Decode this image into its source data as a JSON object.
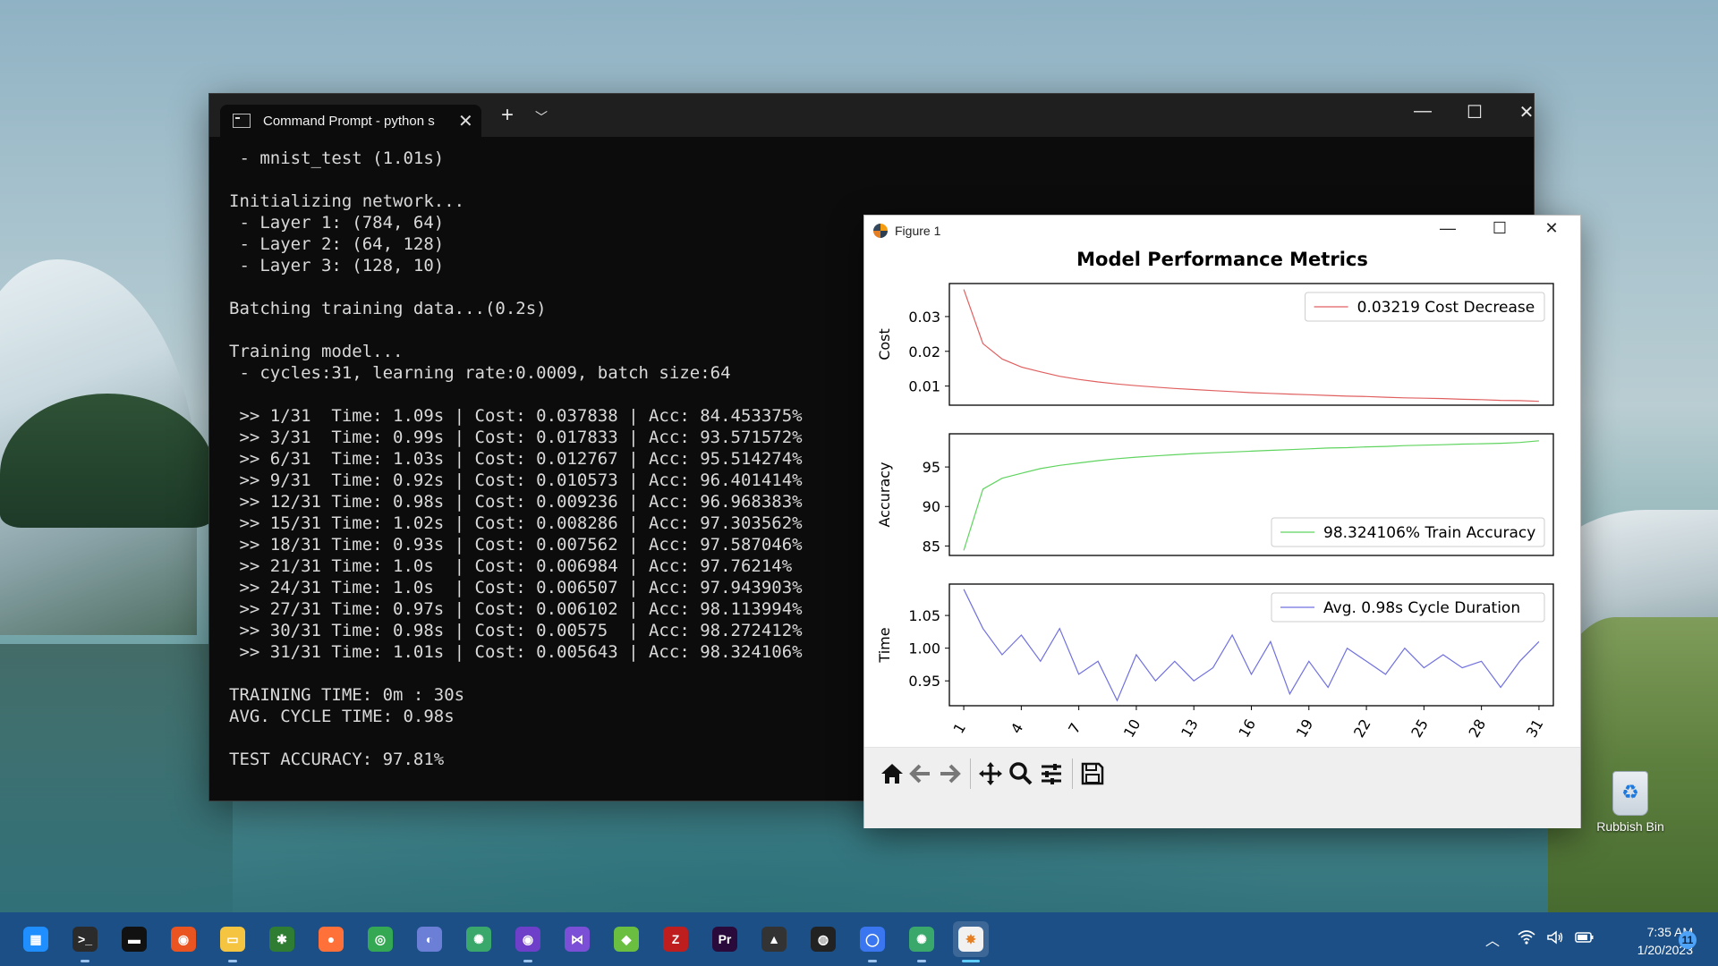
{
  "desktop": {
    "recycle_bin_label": "Rubbish Bin"
  },
  "terminal": {
    "tab_title": "Command Prompt - python s",
    "new_tab_icon": "plus-icon",
    "dropdown_icon": "chevron-down-icon",
    "lines": [
      " - mnist_test (1.01s)",
      "",
      "Initializing network...",
      " - Layer 1: (784, 64)",
      " - Layer 2: (64, 128)",
      " - Layer 3: (128, 10)",
      "",
      "Batching training data...(0.2s)",
      "",
      "Training model...",
      " - cycles:31, learning rate:0.0009, batch size:64",
      "",
      " >> 1/31  Time: 1.09s | Cost: 0.037838 | Acc: 84.453375%",
      " >> 3/31  Time: 0.99s | Cost: 0.017833 | Acc: 93.571572%",
      " >> 6/31  Time: 1.03s | Cost: 0.012767 | Acc: 95.514274%",
      " >> 9/31  Time: 0.92s | Cost: 0.010573 | Acc: 96.401414%",
      " >> 12/31 Time: 0.98s | Cost: 0.009236 | Acc: 96.968383%",
      " >> 15/31 Time: 1.02s | Cost: 0.008286 | Acc: 97.303562%",
      " >> 18/31 Time: 0.93s | Cost: 0.007562 | Acc: 97.587046%",
      " >> 21/31 Time: 1.0s  | Cost: 0.006984 | Acc: 97.76214%",
      " >> 24/31 Time: 1.0s  | Cost: 0.006507 | Acc: 97.943903%",
      " >> 27/31 Time: 0.97s | Cost: 0.006102 | Acc: 98.113994%",
      " >> 30/31 Time: 0.98s | Cost: 0.00575  | Acc: 98.272412%",
      " >> 31/31 Time: 1.01s | Cost: 0.005643 | Acc: 98.324106%",
      "",
      "TRAINING TIME: 0m : 30s",
      "AVG. CYCLE TIME: 0.98s",
      "",
      "TEST ACCURACY: 97.81%"
    ]
  },
  "figure": {
    "window_title": "Figure 1",
    "toolbar_icons": [
      "home-icon",
      "back-arrow-icon",
      "forward-arrow-icon",
      "pan-icon",
      "zoom-icon",
      "configure-subplots-icon",
      "save-icon"
    ]
  },
  "chart_data": [
    {
      "type": "line",
      "title": "Model Performance Metrics",
      "ylabel": "Cost",
      "ylim": [
        0.0045,
        0.0395
      ],
      "yticks": [
        0.01,
        0.02,
        0.03
      ],
      "ytick_labels": [
        "0.01",
        "0.02",
        "0.03"
      ],
      "legend_placement": "upper right",
      "series": [
        {
          "name": "0.03219 Cost Decrease",
          "color": "#e06060",
          "x": [
            1,
            2,
            3,
            4,
            5,
            6,
            7,
            8,
            9,
            10,
            11,
            12,
            13,
            14,
            15,
            16,
            17,
            18,
            19,
            20,
            21,
            22,
            23,
            24,
            25,
            26,
            27,
            28,
            29,
            30,
            31
          ],
          "values": [
            0.0378,
            0.0222,
            0.0178,
            0.0155,
            0.0141,
            0.0128,
            0.0119,
            0.0112,
            0.0106,
            0.0101,
            0.0097,
            0.0093,
            0.009,
            0.0087,
            0.0084,
            0.0081,
            0.0079,
            0.0077,
            0.0075,
            0.0073,
            0.0071,
            0.007,
            0.0068,
            0.0066,
            0.0065,
            0.0064,
            0.0062,
            0.0061,
            0.0059,
            0.0058,
            0.0056
          ]
        }
      ]
    },
    {
      "type": "line",
      "ylabel": "Accuracy",
      "ylim": [
        83.8,
        99.2
      ],
      "yticks": [
        85,
        90,
        95
      ],
      "ytick_labels": [
        "85",
        "90",
        "95"
      ],
      "legend_placement": "lower right",
      "series": [
        {
          "name": "98.324106% Train Accuracy",
          "color": "#5fd45f",
          "x": [
            1,
            2,
            3,
            4,
            5,
            6,
            7,
            8,
            9,
            10,
            11,
            12,
            13,
            14,
            15,
            16,
            17,
            18,
            19,
            20,
            21,
            22,
            23,
            24,
            25,
            26,
            27,
            28,
            29,
            30,
            31
          ],
          "values": [
            84.45,
            92.2,
            93.57,
            94.2,
            94.8,
            95.2,
            95.51,
            95.8,
            96.05,
            96.25,
            96.4,
            96.55,
            96.7,
            96.8,
            96.9,
            97.0,
            97.1,
            97.2,
            97.3,
            97.4,
            97.45,
            97.55,
            97.6,
            97.7,
            97.76,
            97.82,
            97.9,
            97.94,
            98.0,
            98.1,
            98.32
          ]
        }
      ]
    },
    {
      "type": "line",
      "ylabel": "Time",
      "ylim": [
        0.912,
        1.098
      ],
      "yticks": [
        0.95,
        1.0,
        1.05
      ],
      "ytick_labels": [
        "0.95",
        "1.00",
        "1.05"
      ],
      "xlim": [
        0,
        32
      ],
      "xticks": [
        1,
        4,
        7,
        10,
        13,
        16,
        19,
        22,
        25,
        28,
        31
      ],
      "xtick_labels": [
        "1",
        "4",
        "7",
        "10",
        "13",
        "16",
        "19",
        "22",
        "25",
        "28",
        "31"
      ],
      "legend_placement": "upper right",
      "series": [
        {
          "name": "Avg. 0.98s Cycle Duration",
          "color": "#7070e0",
          "x": [
            1,
            2,
            3,
            4,
            5,
            6,
            7,
            8,
            9,
            10,
            11,
            12,
            13,
            14,
            15,
            16,
            17,
            18,
            19,
            20,
            21,
            22,
            23,
            24,
            25,
            26,
            27,
            28,
            29,
            30,
            31
          ],
          "values": [
            1.09,
            1.03,
            0.99,
            1.02,
            0.98,
            1.03,
            0.96,
            0.98,
            0.92,
            0.99,
            0.95,
            0.98,
            0.95,
            0.97,
            1.02,
            0.96,
            1.01,
            0.93,
            0.98,
            0.94,
            1.0,
            0.98,
            0.96,
            1.0,
            0.97,
            0.99,
            0.97,
            0.98,
            0.94,
            0.98,
            1.01
          ]
        }
      ]
    }
  ],
  "taskbar": {
    "apps": [
      {
        "name": "windows-start",
        "color": "#1f8fff",
        "glyph": "▦"
      },
      {
        "name": "terminal",
        "color": "#2b2b2b",
        "glyph": ">_"
      },
      {
        "name": "cmd",
        "color": "#111111",
        "glyph": "▬"
      },
      {
        "name": "ubuntu",
        "color": "#e95420",
        "glyph": "◉"
      },
      {
        "name": "file-explorer",
        "color": "#f5c542",
        "glyph": "▭"
      },
      {
        "name": "spreadsheet",
        "color": "#2e7d32",
        "glyph": "✱"
      },
      {
        "name": "firefox",
        "color": "#ff7139",
        "glyph": "●"
      },
      {
        "name": "chrome",
        "color": "#34a853",
        "glyph": "◎"
      },
      {
        "name": "browser",
        "color": "#6b7fd7",
        "glyph": "◐"
      },
      {
        "name": "atom",
        "color": "#3aa86b",
        "glyph": "✺"
      },
      {
        "name": "github",
        "color": "#6e40c9",
        "glyph": "◉"
      },
      {
        "name": "visual-studio",
        "color": "#7b4fd6",
        "glyph": "⋈"
      },
      {
        "name": "cube-app",
        "color": "#6abf40",
        "glyph": "◆"
      },
      {
        "name": "filezilla",
        "color": "#bf1e1e",
        "glyph": "Z"
      },
      {
        "name": "premiere",
        "color": "#2a0a3a",
        "glyph": "Pr"
      },
      {
        "name": "inkscape",
        "color": "#333333",
        "glyph": "▲"
      },
      {
        "name": "obs",
        "color": "#222222",
        "glyph": "◍"
      },
      {
        "name": "signal",
        "color": "#3a76f0",
        "glyph": "◯"
      },
      {
        "name": "atom-2",
        "color": "#3aa86b",
        "glyph": "✺"
      },
      {
        "name": "matplotlib",
        "color": "#f1f1f1",
        "glyph": "✸"
      }
    ],
    "active_app": "matplotlib",
    "tray_icons": [
      "chevron-up-icon",
      "wifi-icon",
      "volume-icon",
      "battery-icon"
    ],
    "time": "7:35 AM",
    "date": "1/20/2023",
    "notification_count": "11"
  }
}
